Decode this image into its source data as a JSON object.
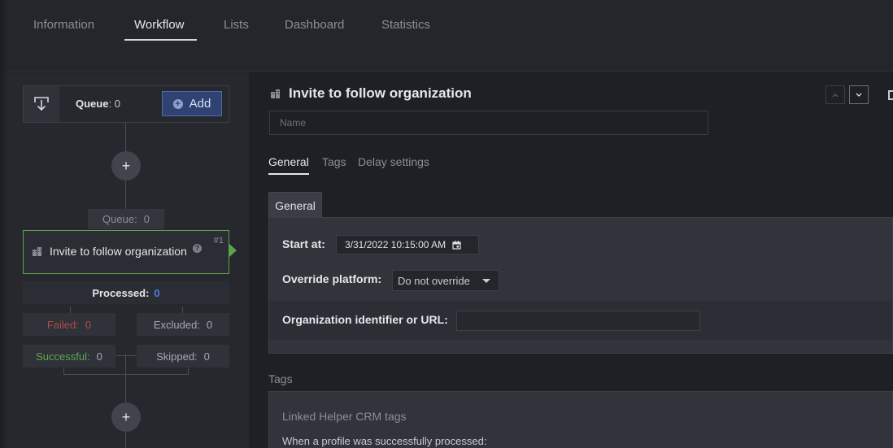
{
  "tabs": [
    {
      "label": "Information",
      "active": false
    },
    {
      "label": "Workflow",
      "active": true
    },
    {
      "label": "Lists",
      "active": false
    },
    {
      "label": "Dashboard",
      "active": false
    },
    {
      "label": "Statistics",
      "active": false
    }
  ],
  "workflow": {
    "queue_label": "Queue",
    "queue_value": ": 0",
    "add_label": "Add",
    "step_queue_label": "Queue:",
    "step_queue_value": "0",
    "action_label": "Invite to follow organization",
    "action_number": "#1",
    "processed_label": "Processed:",
    "processed_value": "0",
    "failed_label": "Failed:",
    "failed_value": "0",
    "excluded_label": "Excluded:",
    "excluded_value": "0",
    "successful_label": "Successful:",
    "successful_value": "0",
    "skipped_label": "Skipped:",
    "skipped_value": "0"
  },
  "detail": {
    "title": "Invite to follow organization",
    "name_placeholder": "Name",
    "subtabs": [
      "General",
      "Tags",
      "Delay settings"
    ],
    "section_tab": "General",
    "start_at_label": "Start at:",
    "start_at_value": "3/31/2022 10:15:00 AM",
    "override_label": "Override platform:",
    "override_value": "Do not override",
    "org_label": "Organization identifier or URL:",
    "org_value": "",
    "tags_label": "Tags",
    "tags_title": "Linked Helper CRM tags",
    "tags_desc": "When a profile was successfully processed:"
  },
  "colors": {
    "accent_green": "#5ba44c",
    "accent_blue": "#4f7ee0",
    "failed_red": "#b04a4e"
  }
}
